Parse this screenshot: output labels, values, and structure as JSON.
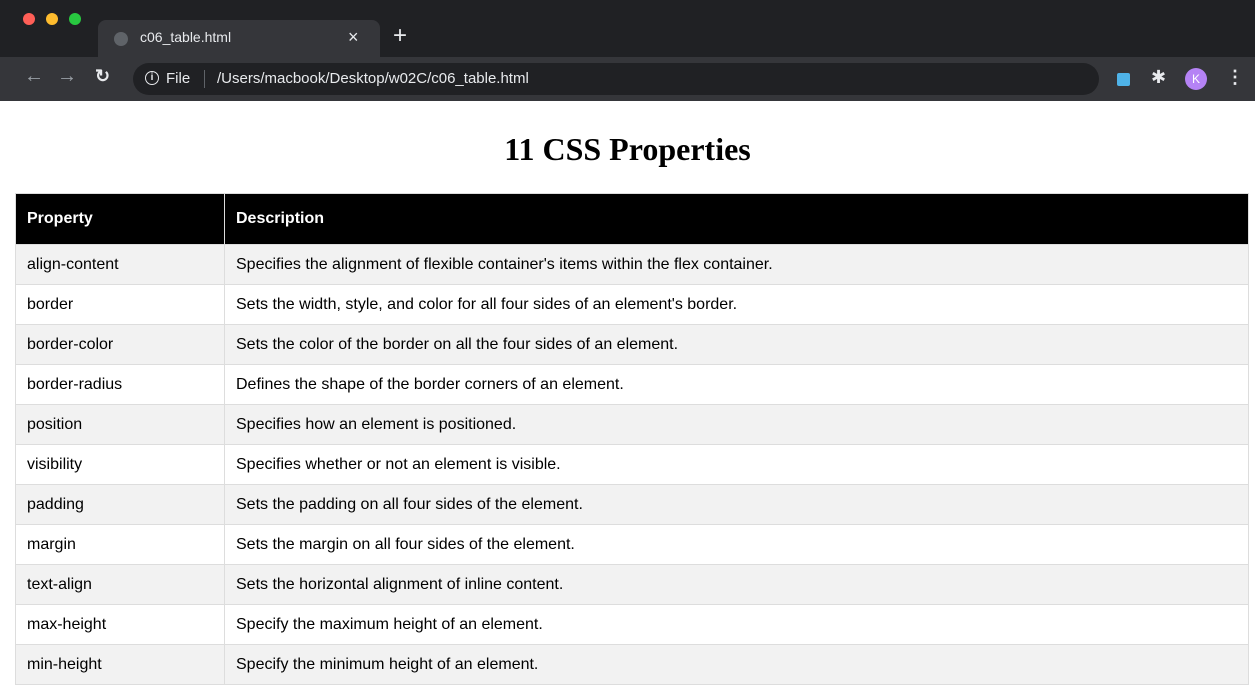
{
  "browser": {
    "tab_title": "c06_table.html",
    "tab_close": "×",
    "new_tab": "+",
    "omnibox": {
      "scheme_label": "File",
      "url": "/Users/macbook/Desktop/w02C/c06_table.html"
    },
    "profile_initial": "K"
  },
  "page": {
    "title": "11 CSS Properties",
    "table": {
      "headers": [
        "Property",
        "Description"
      ],
      "rows": [
        [
          "align-content",
          "Specifies the alignment of flexible container's items within the flex container."
        ],
        [
          "border",
          "Sets the width, style, and color for all four sides of an element's border."
        ],
        [
          "border-color",
          "Sets the color of the border on all the four sides of an element."
        ],
        [
          "border-radius",
          "Defines the shape of the border corners of an element."
        ],
        [
          "position",
          "Specifies how an element is positioned."
        ],
        [
          "visibility",
          "Specifies whether or not an element is visible."
        ],
        [
          "padding",
          "Sets the padding on all four sides of the element."
        ],
        [
          "margin",
          "Sets the margin on all four sides of the element."
        ],
        [
          "text-align",
          "Sets the horizontal alignment of inline content."
        ],
        [
          "max-height",
          "Specify the maximum height of an element."
        ],
        [
          "min-height",
          "Specify the minimum height of an element."
        ]
      ]
    }
  },
  "icons": {
    "back": "arrow-left-icon",
    "forward": "arrow-right-icon",
    "reload": "reload-icon",
    "info": "info-icon",
    "bookmark": "star-icon",
    "extension": "extension-icon",
    "extensions_menu": "puzzle-icon",
    "menu": "kebab-menu-icon"
  },
  "colors": {
    "header_bg": "#000000",
    "header_text": "#ffffff",
    "row_stripe": "#f2f2f2",
    "browser_frame": "#202124"
  }
}
